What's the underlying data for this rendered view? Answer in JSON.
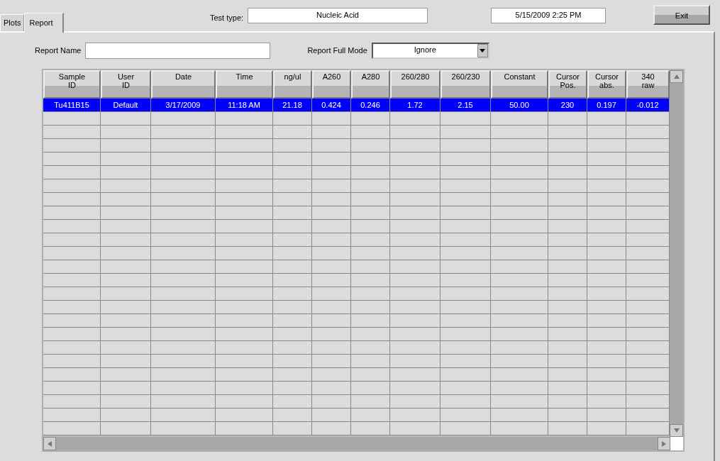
{
  "tabs": [
    {
      "label": "Plots",
      "selected": false
    },
    {
      "label": "Report",
      "selected": true
    }
  ],
  "test_type": {
    "label": "Test type:",
    "value": "Nucleic Acid"
  },
  "datetime": "5/15/2009  2:25 PM",
  "exit_button": "Exit",
  "report_name": {
    "label": "Report Name"
  },
  "report_full_mode": {
    "label": "Report Full Mode",
    "value": "Ignore"
  },
  "table": {
    "columns": [
      "Sample\nID",
      "User\nID",
      "Date",
      "Time",
      "ng/ul",
      "A260",
      "A280",
      "260/280",
      "260/230",
      "Constant",
      "Cursor\nPos.",
      "Cursor\nabs.",
      "340\nraw"
    ],
    "rows": [
      {
        "selected": true,
        "cells": [
          "Tu411B15",
          "Default",
          "3/17/2009",
          "11:18 AM",
          "21.18",
          "0.424",
          "0.246",
          "1.72",
          "2.15",
          "50.00",
          "230",
          "0.197",
          "-0.012"
        ]
      }
    ]
  }
}
